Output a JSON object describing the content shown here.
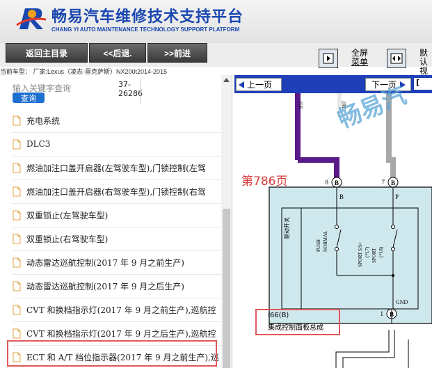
{
  "header": {
    "title": "畅易汽车维修技术支持平台",
    "subtitle": "CHANG YI AUTO MAINTENANCE TECHNOLOGY SUPPORT PLATFORM"
  },
  "toolbar": {
    "back_main": "返回主目录",
    "prev": "<<后退.",
    "next": ">>前进",
    "fullscreen_line1": "全屏",
    "fullscreen_line2": "菜单",
    "default_line1": "默认",
    "default_line2": "视图"
  },
  "vehicle_info": "当前车型：  厂家:Lexus（凌志-雷克萨斯）NX200t2014-2015",
  "left_panel": {
    "search_placeholder": "输入关键字查询",
    "search_button": "查询",
    "page_range_1": "37-",
    "page_range_2": "26286",
    "items": [
      "充电系统",
      "DLC3",
      "燃油加注口盖开启器(左驾驶车型),门锁控制(左驾",
      "燃油加注口盖开启器(右驾驶车型),门锁控制(右驾",
      "双重锁止(左驾驶车型)",
      "双重锁止(右驾驶车型)",
      "动态雷达巡航控制(2017 年 9 月之前生产)",
      "动态雷达巡航控制(2017 年 9 月之后生产)",
      "CVT 和换档指示灯(2017 年 9 月之前生产),巡航控",
      "CVT 和换档指示灯(2017 年 9 月之后生产),巡航控",
      "ECT 和 A/T 档位指示器(2017 年 9 月之前生产),巡"
    ]
  },
  "right_panel": {
    "prev_page": "上一页",
    "next_page": "下一页",
    "watermark": "畅易汽",
    "page_number": "第786页",
    "component_code": "I66(B)",
    "component_name": "集成控制面板总成",
    "pins": {
      "left": "8",
      "right": "7",
      "bottom": "1"
    },
    "wire_left": "B",
    "wire_right": "P",
    "ground_label": "GND",
    "mode_switch": "驱动开关",
    "switch_left_1": "PUSH",
    "switch_left_2": "NORMAL",
    "switch_right_1": "SPORT S/S+",
    "switch_right_2": "(*17)",
    "switch_right_3": "SPORT",
    "switch_right_4": "(*18)",
    "top_wire_label_left": "(LE",
    "top_wire_label_right": "(RE"
  },
  "colors": {
    "brand_blue": "#1a46b0",
    "nav_blue": "#1e3fb8",
    "highlight_red": "#e0585c",
    "wire_purple": "#5a1a8a",
    "wire_gray": "#a8a8a8",
    "component_fill": "#cfe8ee"
  }
}
